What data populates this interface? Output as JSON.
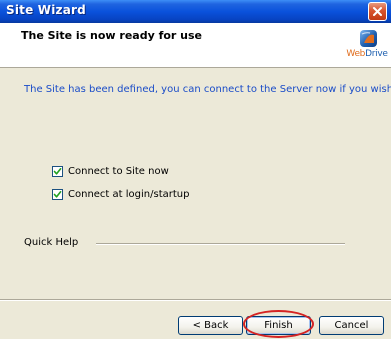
{
  "window": {
    "title": "Site Wizard",
    "close_icon": "close-icon"
  },
  "header": {
    "title": "The Site is now ready for use",
    "logo": {
      "icon": "webdrive-logo-icon",
      "text_web": "Web",
      "text_drive": "Drive",
      "colors": {
        "web": "#e06d1e",
        "drive": "#1d5fb0"
      }
    }
  },
  "main": {
    "info_text": "The Site has been defined, you can connect to the Server now if you wish.",
    "options": [
      {
        "label": "Connect to Site now",
        "checked": true
      },
      {
        "label": "Connect at login/startup",
        "checked": true
      }
    ],
    "quick_help_label": "Quick Help"
  },
  "buttons": {
    "back_label": "< Back",
    "finish_label": "Finish",
    "cancel_label": "Cancel"
  },
  "colors": {
    "titlebar": "#0a52dc",
    "dialog_bg": "#ece9d8",
    "info_text": "#1a4cc8",
    "highlight": "#d42323"
  }
}
